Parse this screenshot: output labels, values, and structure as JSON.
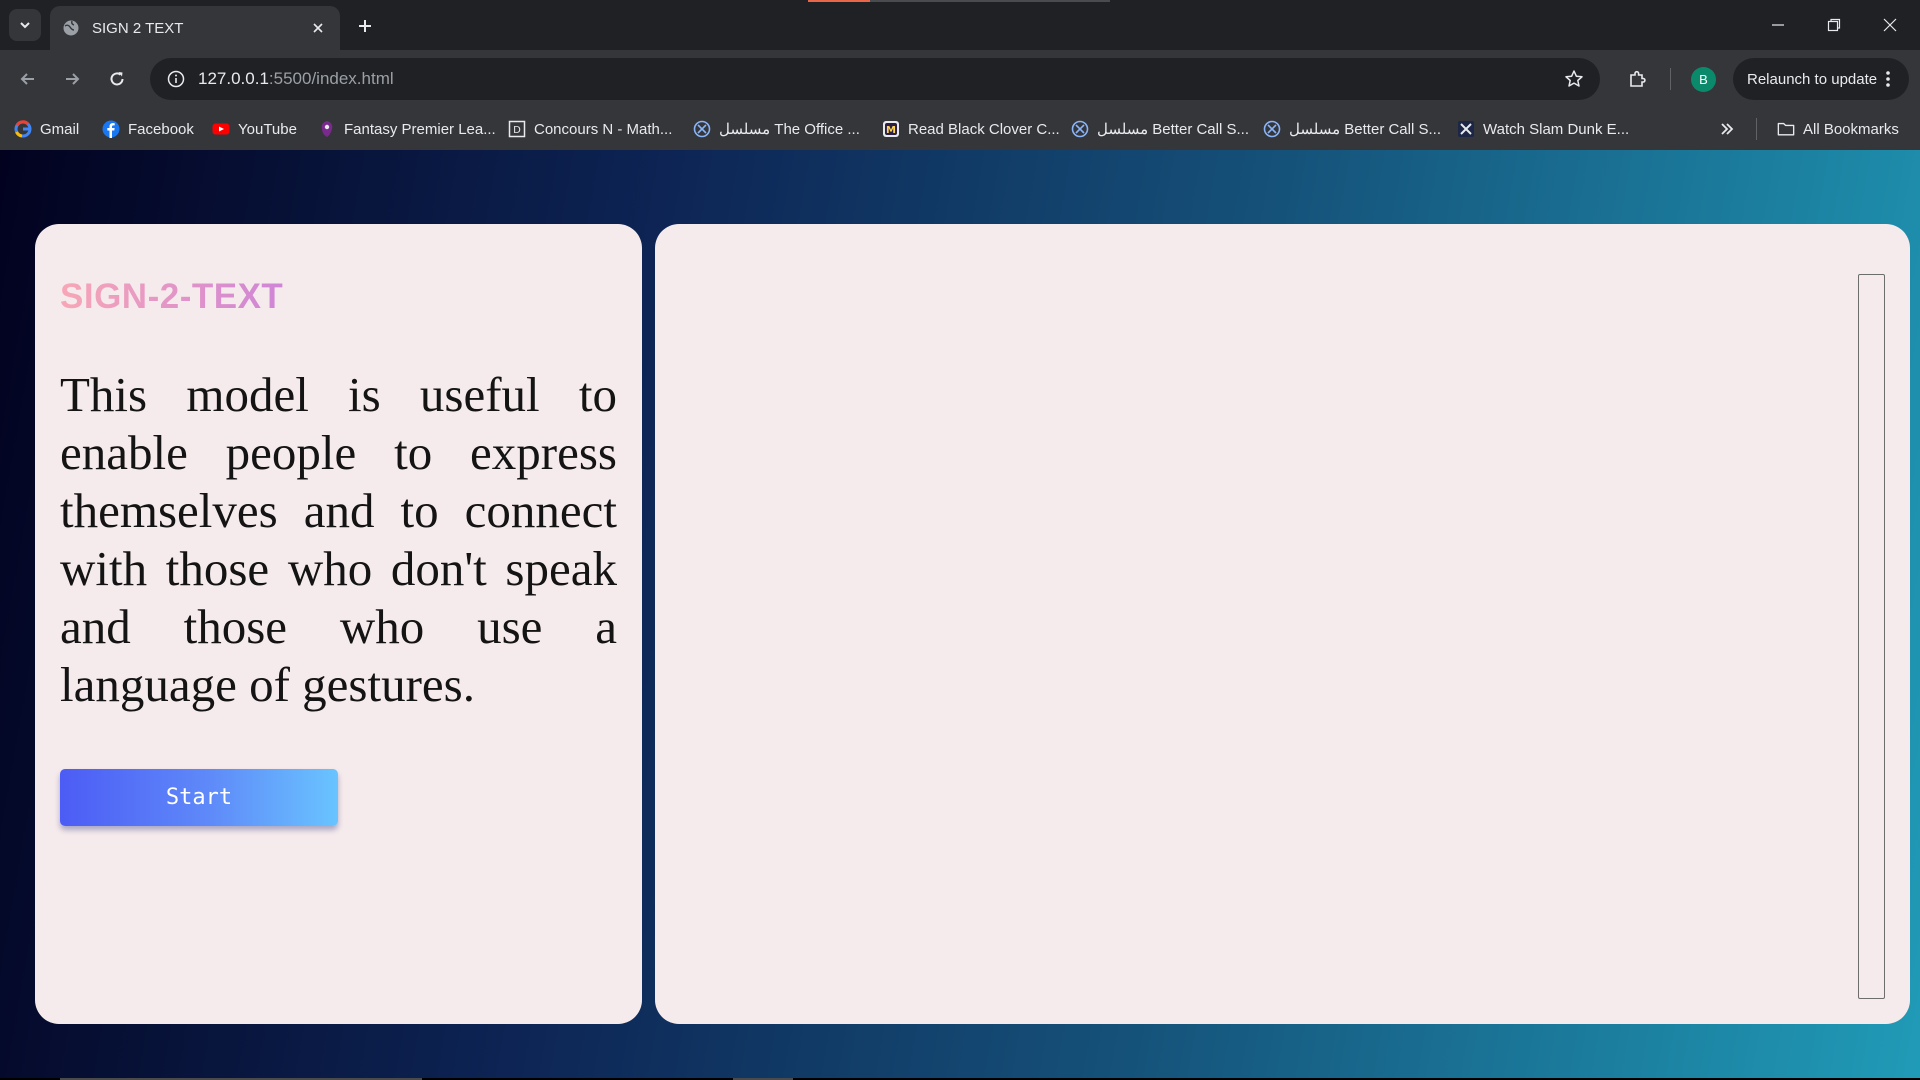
{
  "browser": {
    "tab": {
      "title": "SIGN 2 TEXT",
      "favicon": "globe-icon"
    },
    "address_bar": {
      "host": "127.0.0.1",
      "path": ":5500/index.html"
    },
    "profile_initial": "B",
    "relaunch_label": "Relaunch to update",
    "bookmarks": [
      {
        "label": "Gmail",
        "icon": "google-icon"
      },
      {
        "label": "Facebook",
        "icon": "facebook-icon"
      },
      {
        "label": "YouTube",
        "icon": "youtube-icon"
      },
      {
        "label": "Fantasy Premier Lea...",
        "icon": "premier-league-icon"
      },
      {
        "label": "Concours N - Math...",
        "icon": "document-icon"
      },
      {
        "label": "مسلسل The Office ...",
        "icon": "streaming-icon"
      },
      {
        "label": "Read Black Clover C...",
        "icon": "manga-icon"
      },
      {
        "label": "مسلسل Better Call S...",
        "icon": "streaming-icon"
      },
      {
        "label": "مسلسل Better Call S...",
        "icon": "streaming-icon"
      },
      {
        "label": "Watch Slam Dunk E...",
        "icon": "anime-icon"
      }
    ],
    "all_bookmarks_label": "All Bookmarks"
  },
  "app": {
    "brand": "SIGN-2-TEXT",
    "description": "This model is useful to enable people to express themselves and to connect with those who don't speak and those who use a language of gestures.",
    "start_label": "Start"
  },
  "colors": {
    "card_bg": "#f6ebec",
    "brand_gradient_start": "#f7a7b6",
    "brand_gradient_end": "#cf85d7",
    "button_gradient_start": "#4c5cf5",
    "button_gradient_end": "#69c4ff",
    "page_gradient_start": "#02021f",
    "page_gradient_end": "#209bb7"
  }
}
